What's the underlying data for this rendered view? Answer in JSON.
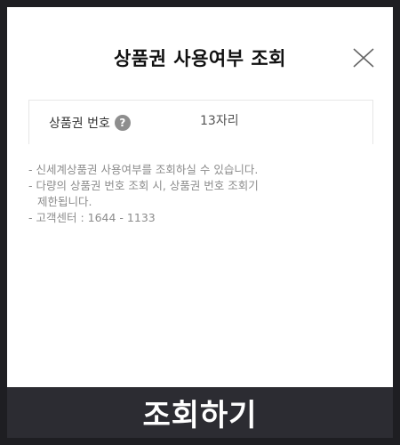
{
  "modal": {
    "title": "상품권 사용여부 조회"
  },
  "form": {
    "label": "상품권 번호",
    "help_icon_text": "?",
    "placeholder": "13자리"
  },
  "notes": {
    "line1": "- 신세계상품권 사용여부를 조회하실 수 있습니다.",
    "line2a": "- 다량의 상품권 번호 조회 시, 상품권 번호 조회기",
    "line2b": "제한됩니다.",
    "line3": "- 고객센터 : 1644 - 1133"
  },
  "actions": {
    "submit_label": "조회하기"
  },
  "colors": {
    "page_background": "#1e1e22",
    "modal_background": "#ffffff",
    "button_background": "#2c2c32",
    "note_text": "#8c8c8c",
    "help_icon": "#8e8e8e"
  },
  "icons": {
    "close": "close-icon",
    "help": "help-icon"
  }
}
